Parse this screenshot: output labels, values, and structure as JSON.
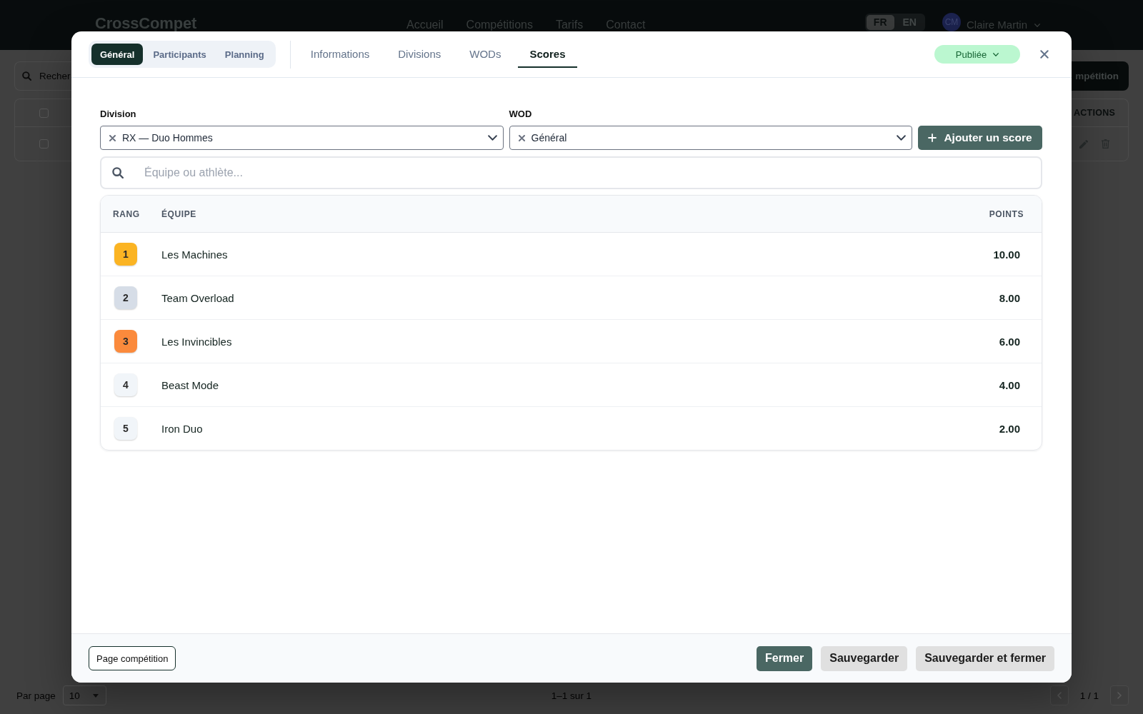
{
  "top_bar": {
    "logo": "CrossCompet",
    "nav": [
      "Accueil",
      "Compétitions",
      "Tarifs",
      "Contact"
    ],
    "languages": [
      {
        "label": "FR",
        "selected": true
      },
      {
        "label": "EN",
        "selected": false
      }
    ],
    "user": {
      "initials": "CM",
      "name": "Claire Martin"
    }
  },
  "page": {
    "search": {
      "placeholder": "Recher"
    },
    "action_button": "mpétition",
    "table": {
      "select_all": {
        "checked": false
      },
      "columns": [
        "ACTIONS"
      ],
      "rows": [
        {
          "checked": false
        }
      ]
    },
    "pagination": {
      "per_page_label": "Par page",
      "per_page": "10",
      "summary": "1–1 sur 1",
      "page": "1 / 1"
    }
  },
  "modal": {
    "views": [
      {
        "label": "Général",
        "selected": true
      },
      {
        "label": "Participants",
        "selected": false
      },
      {
        "label": "Planning",
        "selected": false
      }
    ],
    "tabs": [
      {
        "label": "Informations",
        "selected": false
      },
      {
        "label": "Divisions",
        "selected": false
      },
      {
        "label": "WODs",
        "selected": false
      },
      {
        "label": "Scores",
        "selected": true
      }
    ],
    "status": {
      "label": "Publiée"
    },
    "filters": [
      {
        "label": "Division",
        "value": "RX — Duo Hommes"
      },
      {
        "label": "WOD",
        "value": "Général"
      }
    ],
    "add_button": "Ajouter un score",
    "search": {
      "placeholder": "Équipe ou athlète..."
    },
    "table": {
      "columns": [
        "RANG",
        "ÉQUIPE",
        "POINTS"
      ],
      "rows": [
        {
          "rank": "1",
          "team": "Les Machines",
          "points": "10.00",
          "color": "#fbb423"
        },
        {
          "rank": "2",
          "team": "Team Overload",
          "points": "8.00",
          "color": "#d6dde7"
        },
        {
          "rank": "3",
          "team": "Les Invincibles",
          "points": "6.00",
          "color": "#fb8a3c"
        },
        {
          "rank": "4",
          "team": "Beast Mode",
          "points": "4.00",
          "color": "#f1f5f9"
        },
        {
          "rank": "5",
          "team": "Iron Duo",
          "points": "2.00",
          "color": "#f1f5f9"
        }
      ]
    },
    "footer": {
      "link_button": "Page compétition",
      "buttons": [
        {
          "label": "Fermer",
          "kind": "primary"
        },
        {
          "label": "Sauvegarder",
          "kind": "secondary"
        },
        {
          "label": "Sauvegarder et fermer",
          "kind": "secondary"
        }
      ]
    }
  }
}
